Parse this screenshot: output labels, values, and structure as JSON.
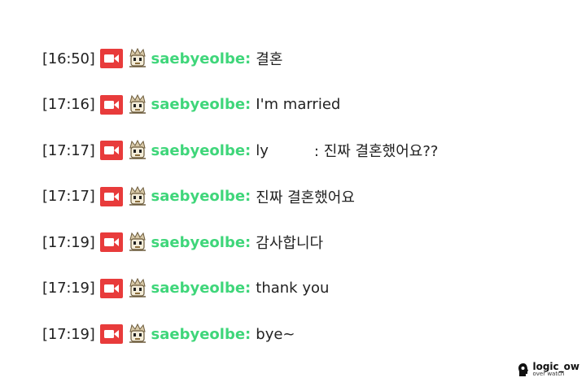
{
  "colors": {
    "username": "#3fd67a",
    "camera_badge": "#e83b3b",
    "text": "#222222"
  },
  "messages": [
    {
      "time": "[16:50]",
      "user": "saebyeolbe:",
      "text": "결혼",
      "redacted": false
    },
    {
      "time": "[17:16]",
      "user": "saebyeolbe:",
      "text": "I'm married",
      "redacted": false
    },
    {
      "time": "[17:17]",
      "user": "saebyeolbe:",
      "text_pre": "ly",
      "text_post": ": 진짜 결혼했어요??",
      "redacted": true
    },
    {
      "time": "[17:17]",
      "user": "saebyeolbe:",
      "text": "진짜 결혼했어요",
      "redacted": false
    },
    {
      "time": "[17:19]",
      "user": "saebyeolbe:",
      "text": "감사합니다",
      "redacted": false
    },
    {
      "time": "[17:19]",
      "user": "saebyeolbe:",
      "text": "thank you",
      "redacted": false
    },
    {
      "time": "[17:19]",
      "user": "saebyeolbe:",
      "text": "bye~",
      "redacted": false
    }
  ],
  "icons": {
    "camera": "video-camera-icon",
    "badge": "subscriber-badge-icon",
    "watermark": "head-silhouette-icon"
  },
  "watermark": {
    "main": "logic_ow",
    "sub": "over watch"
  }
}
